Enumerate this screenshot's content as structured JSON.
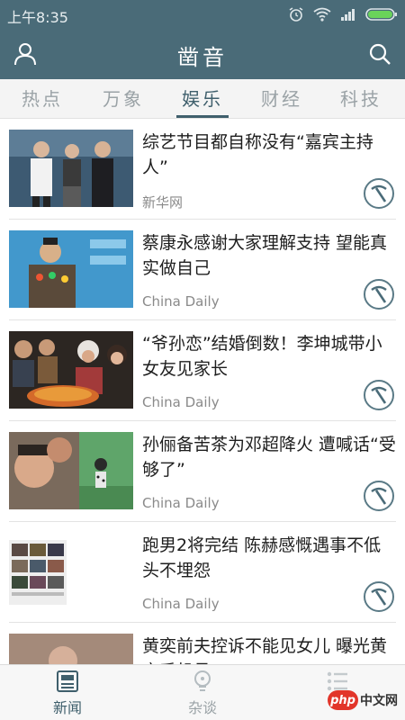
{
  "status_bar": {
    "time": "上午8:35"
  },
  "app_bar": {
    "title": "凿音"
  },
  "tabs": [
    {
      "label": "热点",
      "active": false
    },
    {
      "label": "万象",
      "active": false
    },
    {
      "label": "娱乐",
      "active": true
    },
    {
      "label": "财经",
      "active": false
    },
    {
      "label": "科技",
      "active": false
    }
  ],
  "news": [
    {
      "title": "综艺节目都自称没有“嘉宾主持人”",
      "source": "新华网"
    },
    {
      "title": "蔡康永感谢大家理解支持 望能真实做自己",
      "source": "China Daily"
    },
    {
      "title": "“爷孙恋”结婚倒数！李坤城带小女友见家长",
      "source": "China Daily"
    },
    {
      "title": "孙俪备苦茶为邓超降火 遭喊话“受够了”",
      "source": "China Daily"
    },
    {
      "title": "跑男2将完结 陈赫感慨遇事不低头不埋怨",
      "source": "China Daily"
    },
    {
      "title": "黄奕前夫控诉不能见女儿 曝光黄奕手机号",
      "source": ""
    }
  ],
  "bottom_nav": [
    {
      "label": "新闻",
      "icon": "newspaper-icon",
      "active": true
    },
    {
      "label": "杂谈",
      "icon": "lightbulb-icon",
      "active": false
    },
    {
      "label": "",
      "icon": "list-icon",
      "active": false
    }
  ],
  "watermark": {
    "logo": "php",
    "text": "中文网"
  },
  "colors": {
    "primary": "#4a6b78",
    "accent": "#3f5f6c",
    "inactive": "#9aa2a6"
  }
}
